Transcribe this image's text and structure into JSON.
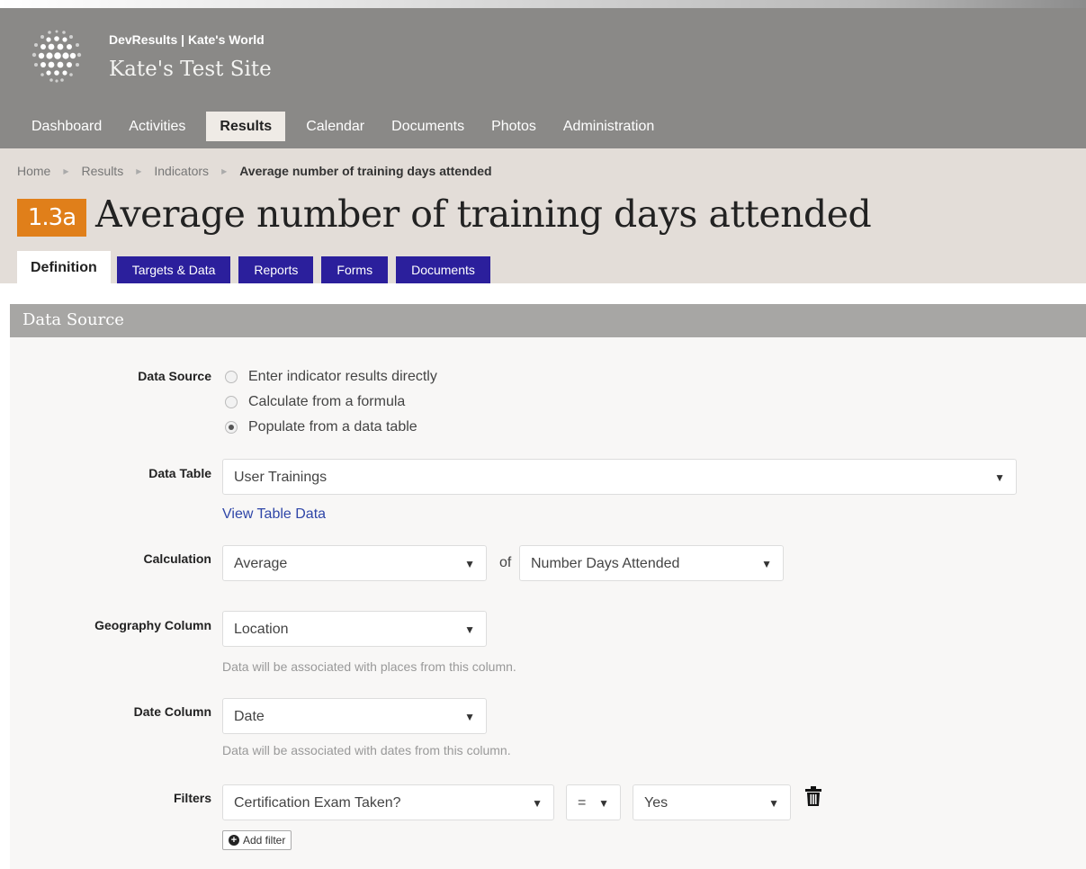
{
  "header": {
    "org_name": "DevResults | Kate's World",
    "site_name": "Kate's Test Site"
  },
  "main_nav": {
    "items": [
      "Dashboard",
      "Activities",
      "Results",
      "Calendar",
      "Documents",
      "Photos",
      "Administration"
    ],
    "active": "Results"
  },
  "breadcrumb": {
    "items": [
      "Home",
      "Results",
      "Indicators"
    ],
    "current": "Average number of training days attended"
  },
  "indicator": {
    "code": "1.3a",
    "title": "Average number of training days attended"
  },
  "tabs": {
    "items": [
      "Definition",
      "Targets & Data",
      "Reports",
      "Forms",
      "Documents"
    ],
    "active": "Definition"
  },
  "section": {
    "title": "Data Source"
  },
  "form": {
    "data_source": {
      "label": "Data Source",
      "options": [
        "Enter indicator results directly",
        "Calculate from a formula",
        "Populate from a data table"
      ],
      "selected": "Populate from a data table"
    },
    "data_table": {
      "label": "Data Table",
      "value": "User Trainings",
      "link": "View Table Data"
    },
    "calculation": {
      "label": "Calculation",
      "value": "Average",
      "of_text": "of",
      "column": "Number Days Attended"
    },
    "geography": {
      "label": "Geography Column",
      "value": "Location",
      "hint": "Data will be associated with places from this column."
    },
    "date": {
      "label": "Date Column",
      "value": "Date",
      "hint": "Data will be associated with dates from this column."
    },
    "filters": {
      "label": "Filters",
      "column": "Certification Exam Taken?",
      "operator": "=",
      "value": "Yes",
      "add_label": "Add filter"
    }
  },
  "icons": {
    "logo": "globe-dots-icon",
    "breadcrumb_separator": "triangle-right-icon",
    "dropdown": "triangle-down-icon",
    "delete": "trash-icon",
    "add": "plus-circle-icon"
  },
  "colors": {
    "header_bg": "#8a8987",
    "breadcrumb_bg": "#e3ddd8",
    "badge": "#e07f1a",
    "tab_blue": "#2b1f9c",
    "section_bar": "#a7a6a4",
    "link": "#2f46a8"
  }
}
